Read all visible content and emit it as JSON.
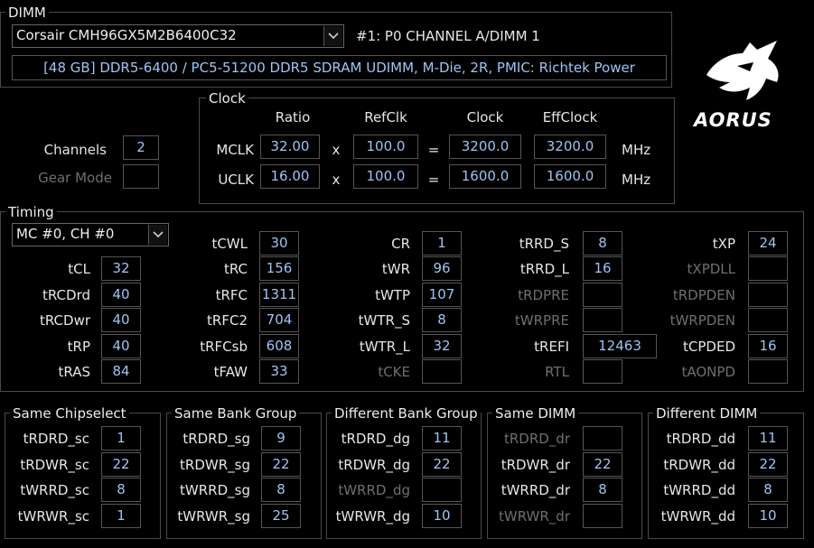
{
  "dimm": {
    "legend": "DIMM",
    "module_select": "Corsair CMH96GX5M2B6400C32",
    "slot": "#1: P0 CHANNEL A/DIMM 1",
    "description": "[48 GB] DDR5-6400 / PC5-51200 DDR5 SDRAM UDIMM, M-Die, 2R, PMIC: Richtek Power"
  },
  "logo": {
    "text": "AORUS",
    "icon": "aorus-eagle-logo"
  },
  "clock": {
    "legend": "Clock",
    "headers": {
      "ratio": "Ratio",
      "refclk": "RefClk",
      "clock": "Clock",
      "effclock": "EffClock"
    },
    "mclk": {
      "label": "MCLK",
      "ratio": "32.00",
      "x": "x",
      "refclk": "100.0",
      "eq": "=",
      "clock": "3200.0",
      "effclock": "3200.0",
      "unit": "MHz"
    },
    "uclk": {
      "label": "UCLK",
      "ratio": "16.00",
      "x": "x",
      "refclk": "100.0",
      "eq": "=",
      "clock": "1600.0",
      "effclock": "1600.0",
      "unit": "MHz"
    }
  },
  "channels": {
    "label": "Channels",
    "value": "2"
  },
  "gear_mode": {
    "label": "Gear Mode",
    "value": ""
  },
  "timing": {
    "legend": "Timing",
    "mc_select": "MC #0, CH #0",
    "col1": [
      {
        "label": "tCL",
        "value": "32"
      },
      {
        "label": "tRCDrd",
        "value": "40"
      },
      {
        "label": "tRCDwr",
        "value": "40"
      },
      {
        "label": "tRP",
        "value": "40"
      },
      {
        "label": "tRAS",
        "value": "84"
      }
    ],
    "col2": [
      {
        "label": "tCWL",
        "value": "30"
      },
      {
        "label": "tRC",
        "value": "156"
      },
      {
        "label": "tRFC",
        "value": "1311"
      },
      {
        "label": "tRFC2",
        "value": "704"
      },
      {
        "label": "tRFCsb",
        "value": "608"
      },
      {
        "label": "tFAW",
        "value": "33"
      }
    ],
    "col3": [
      {
        "label": "CR",
        "value": "1"
      },
      {
        "label": "tWR",
        "value": "96"
      },
      {
        "label": "tWTP",
        "value": "107"
      },
      {
        "label": "tWTR_S",
        "value": "8"
      },
      {
        "label": "tWTR_L",
        "value": "32"
      },
      {
        "label": "tCKE",
        "value": ""
      }
    ],
    "col4": [
      {
        "label": "tRRD_S",
        "value": "8"
      },
      {
        "label": "tRRD_L",
        "value": "16"
      },
      {
        "label": "tRDPRE",
        "value": ""
      },
      {
        "label": "tWRPRE",
        "value": ""
      },
      {
        "label": "tREFI",
        "value": "12463"
      },
      {
        "label": "RTL",
        "value": ""
      }
    ],
    "col5": [
      {
        "label": "tXP",
        "value": "24"
      },
      {
        "label": "tXPDLL",
        "value": ""
      },
      {
        "label": "tRDPDEN",
        "value": ""
      },
      {
        "label": "tWRPDEN",
        "value": ""
      },
      {
        "label": "tCPDED",
        "value": "16"
      },
      {
        "label": "tAONPD",
        "value": ""
      }
    ]
  },
  "groups": [
    {
      "legend": "Same Chipselect",
      "rows": [
        {
          "label": "tRDRD_sc",
          "value": "1"
        },
        {
          "label": "tRDWR_sc",
          "value": "22"
        },
        {
          "label": "tWRRD_sc",
          "value": "8"
        },
        {
          "label": "tWRWR_sc",
          "value": "1"
        }
      ]
    },
    {
      "legend": "Same Bank Group",
      "rows": [
        {
          "label": "tRDRD_sg",
          "value": "9"
        },
        {
          "label": "tRDWR_sg",
          "value": "22"
        },
        {
          "label": "tWRRD_sg",
          "value": "8"
        },
        {
          "label": "tWRWR_sg",
          "value": "25"
        }
      ]
    },
    {
      "legend": "Different Bank Group",
      "rows": [
        {
          "label": "tRDRD_dg",
          "value": "11"
        },
        {
          "label": "tRDWR_dg",
          "value": "22"
        },
        {
          "label": "tWRRD_dg",
          "value": ""
        },
        {
          "label": "tWRWR_dg",
          "value": "10"
        }
      ]
    },
    {
      "legend": "Same DIMM",
      "rows": [
        {
          "label": "tRDRD_dr",
          "value": ""
        },
        {
          "label": "tRDWR_dr",
          "value": "22"
        },
        {
          "label": "tWRRD_dr",
          "value": "8"
        },
        {
          "label": "tWRWR_dr",
          "value": ""
        }
      ]
    },
    {
      "legend": "Different DIMM",
      "rows": [
        {
          "label": "tRDRD_dd",
          "value": "11"
        },
        {
          "label": "tRDWR_dd",
          "value": "22"
        },
        {
          "label": "tWRRD_dd",
          "value": "8"
        },
        {
          "label": "tWRWR_dd",
          "value": "10"
        }
      ]
    }
  ],
  "colors": {
    "background": "#000000",
    "value_text": "#9ec4f2",
    "border": "#555555",
    "disabled_label": "#6f6f6f"
  }
}
